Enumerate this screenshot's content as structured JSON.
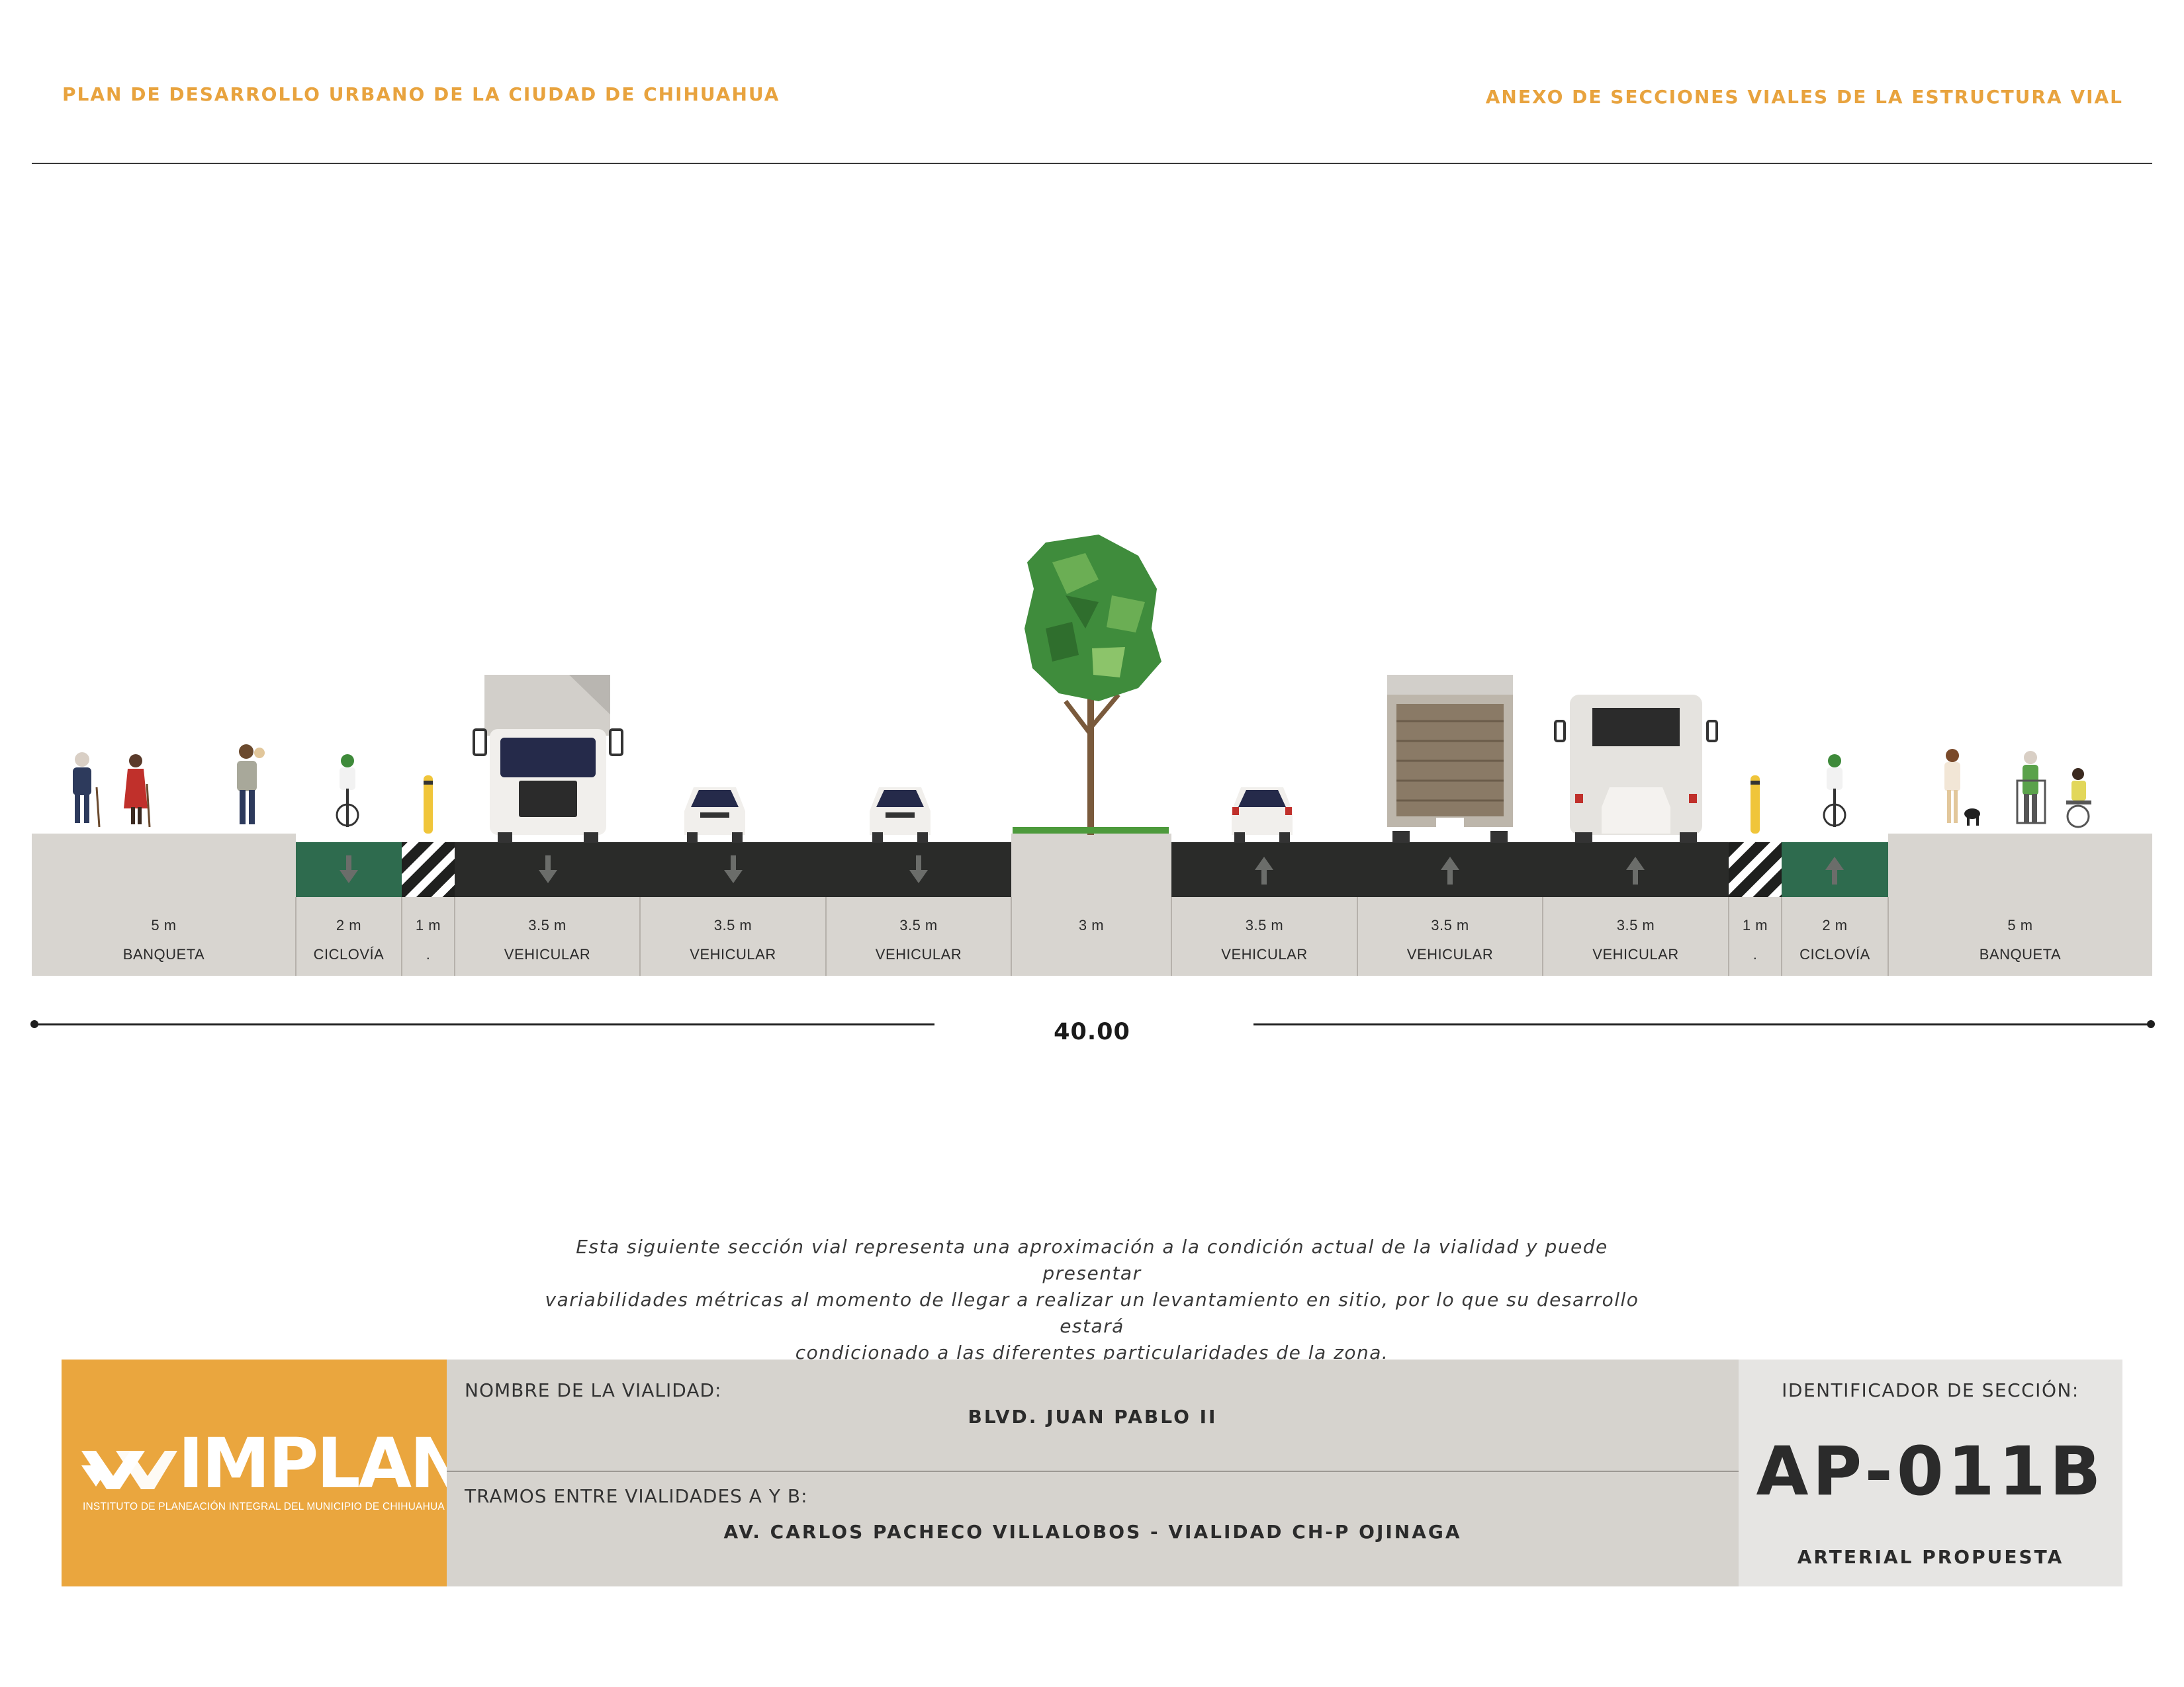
{
  "header": {
    "left_title": "PLAN DE DESARROLLO URBANO DE LA CIUDAD DE CHIHUAHUA",
    "right_title": "ANEXO DE SECCIONES VIALES DE LA ESTRUCTURA VIAL"
  },
  "section": {
    "segments": [
      {
        "width": "5 m",
        "name": "BANQUETA",
        "type": "sidewalk",
        "arrow": "none",
        "meters": 5
      },
      {
        "width": "2 m",
        "name": "CICLOVÍA",
        "type": "bike",
        "arrow": "down",
        "meters": 2
      },
      {
        "width": "1 m",
        "name": ".",
        "type": "buffer",
        "arrow": "none",
        "meters": 1
      },
      {
        "width": "3.5 m",
        "name": "VEHICULAR",
        "type": "vehicle",
        "arrow": "down",
        "meters": 3.5
      },
      {
        "width": "3.5 m",
        "name": "VEHICULAR",
        "type": "vehicle",
        "arrow": "down",
        "meters": 3.5
      },
      {
        "width": "3.5 m",
        "name": "VEHICULAR",
        "type": "vehicle",
        "arrow": "down",
        "meters": 3.5
      },
      {
        "width": "3 m",
        "name": "",
        "type": "median",
        "arrow": "none",
        "meters": 3
      },
      {
        "width": "3.5 m",
        "name": "VEHICULAR",
        "type": "vehicle",
        "arrow": "up",
        "meters": 3.5
      },
      {
        "width": "3.5 m",
        "name": "VEHICULAR",
        "type": "vehicle",
        "arrow": "up",
        "meters": 3.5
      },
      {
        "width": "3.5 m",
        "name": "VEHICULAR",
        "type": "vehicle",
        "arrow": "up",
        "meters": 3.5
      },
      {
        "width": "1 m",
        "name": ".",
        "type": "buffer",
        "arrow": "none",
        "meters": 1
      },
      {
        "width": "2 m",
        "name": "CICLOVÍA",
        "type": "bike",
        "arrow": "up",
        "meters": 2
      },
      {
        "width": "5 m",
        "name": "BANQUETA",
        "type": "sidewalk",
        "arrow": "none",
        "meters": 5
      }
    ],
    "total": "40.00"
  },
  "disclaimer": {
    "line1": "Esta siguiente sección vial representa una aproximación a la condición actual de la vialidad y puede presentar",
    "line2": "variabilidades métricas al momento de llegar a realizar un levantamiento en sitio, por lo que su desarrollo estará",
    "line3": "condicionado a las diferentes particularidades de la zona."
  },
  "footer": {
    "logo_word": "IMPLAN",
    "logo_subtitle": "INSTITUTO DE PLANEACIÓN INTEGRAL DEL MUNICIPIO DE CHIHUAHUA",
    "name_label": "NOMBRE DE LA VIALIDAD:",
    "name_value": "BLVD. JUAN PABLO II",
    "tramo_label": "TRAMOS ENTRE VIALIDADES A Y B:",
    "tramo_value": "AV. CARLOS PACHECO VILLALOBOS - VIALIDAD CH-P OJINAGA",
    "id_label": "IDENTIFICADOR DE SECCIÓN:",
    "id_value": "AP-011B",
    "classification": "ARTERIAL PROPUESTA"
  },
  "colors": {
    "accent": "#E8A33E",
    "logo_bg": "#EAA63E",
    "asphalt": "#2A2B29",
    "bike_lane": "#2E6B4E",
    "sidewalk": "#D8D5D0",
    "tree_green": "#3F8C3C"
  }
}
